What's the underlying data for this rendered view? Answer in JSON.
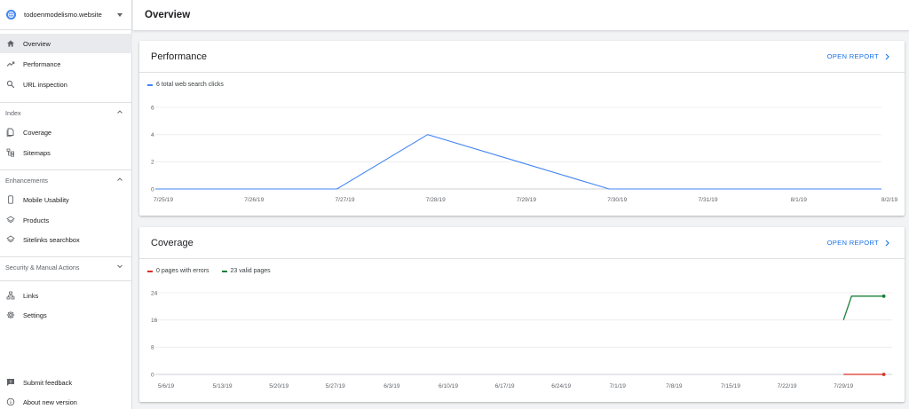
{
  "property": {
    "name": "todoenmodelismo.website"
  },
  "header": {
    "title": "Overview"
  },
  "sidebar": {
    "top_items": [
      {
        "label": "Overview",
        "icon": "home-icon",
        "active": true
      },
      {
        "label": "Performance",
        "icon": "trending-up-icon"
      },
      {
        "label": "URL inspection",
        "icon": "search-icon"
      }
    ],
    "sections": {
      "index": "Index",
      "enhancements": "Enhancements",
      "security": "Security & Manual Actions"
    },
    "index_items": [
      {
        "label": "Coverage",
        "icon": "file-copy-icon"
      },
      {
        "label": "Sitemaps",
        "icon": "sitemap-icon"
      }
    ],
    "enhancement_items": [
      {
        "label": "Mobile Usability",
        "icon": "smartphone-icon"
      },
      {
        "label": "Products",
        "icon": "layers-icon"
      },
      {
        "label": "Sitelinks searchbox",
        "icon": "layers-icon"
      }
    ],
    "other_items": [
      {
        "label": "Links",
        "icon": "links-icon"
      },
      {
        "label": "Settings",
        "icon": "gear-icon"
      }
    ],
    "footer_items": [
      {
        "label": "Submit feedback",
        "icon": "feedback-icon"
      },
      {
        "label": "About new version",
        "icon": "info-icon"
      }
    ]
  },
  "performance": {
    "title": "Performance",
    "open_report": "OPEN REPORT",
    "legend": "6 total web search clicks"
  },
  "coverage": {
    "title": "Coverage",
    "open_report": "OPEN REPORT",
    "legend_errors": "0 pages with errors",
    "legend_valid": "23 valid pages"
  },
  "colors": {
    "accent": "#1a73e8",
    "clicks": "#4285f4",
    "errors": "#d93025",
    "valid": "#188038"
  },
  "chart_data": [
    {
      "type": "line",
      "x": [
        "7/25/19",
        "7/26/19",
        "7/27/19",
        "7/28/19",
        "7/29/19",
        "7/30/19",
        "7/31/19",
        "8/1/19",
        "8/2/19"
      ],
      "series": [
        {
          "name": "6 total web search clicks",
          "values": [
            0,
            0,
            0,
            4,
            2,
            0,
            0,
            0,
            0
          ]
        }
      ],
      "yticks": [
        0,
        2,
        4,
        6
      ],
      "ylim": [
        0,
        6
      ],
      "grid": true
    },
    {
      "type": "line",
      "x": [
        "5/6/19",
        "5/13/19",
        "5/20/19",
        "5/27/19",
        "6/3/19",
        "6/10/19",
        "6/17/19",
        "6/24/19",
        "7/1/19",
        "7/8/19",
        "7/15/19",
        "7/22/19",
        "7/29/19"
      ],
      "series": [
        {
          "name": "0 pages with errors",
          "points": [
            [
              "7/29/19",
              0
            ],
            [
              "8/3/19",
              0
            ]
          ]
        },
        {
          "name": "23 valid pages",
          "points": [
            [
              "7/29/19",
              16
            ],
            [
              "7/30/19",
              23
            ],
            [
              "8/3/19",
              23
            ]
          ]
        }
      ],
      "yticks": [
        0,
        8,
        16,
        24
      ],
      "ylim": [
        0,
        24
      ],
      "grid": true
    }
  ]
}
